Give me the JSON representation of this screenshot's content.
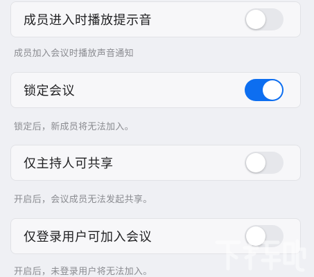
{
  "settings": [
    {
      "label": "成员进入时播放提示音",
      "description": "成员加入会议时播放声音通知",
      "enabled": false
    },
    {
      "label": "锁定会议",
      "description": "锁定后，新成员将无法加入。",
      "enabled": true
    },
    {
      "label": "仅主持人可共享",
      "description": "开启后，会议成员无法发起共享。",
      "enabled": false
    },
    {
      "label": "仅登录用户可加入会议",
      "description": "开启后，未登录用户将无法加入。",
      "enabled": false
    }
  ],
  "colors": {
    "accent": "#0d6ef0",
    "toggle_off": "#e6e7eb",
    "background": "#eff0f4"
  },
  "watermark": {
    "text": "下载吧"
  }
}
